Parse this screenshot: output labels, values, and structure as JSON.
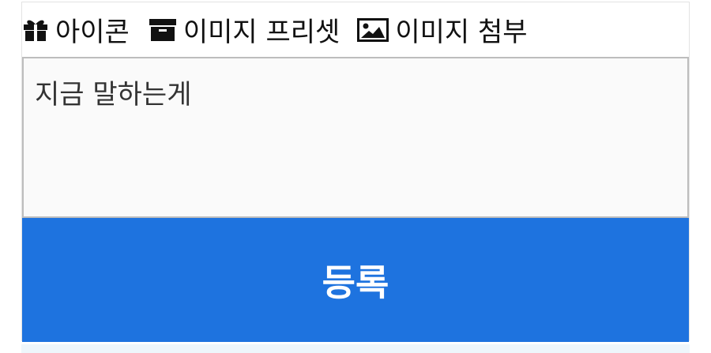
{
  "toolbar": {
    "items": [
      {
        "label": "아이콘",
        "icon": "gift-icon"
      },
      {
        "label": "이미지 프리셋",
        "icon": "archive-box-icon"
      },
      {
        "label": "이미지 첨부",
        "icon": "image-icon"
      }
    ]
  },
  "comment": {
    "value": "지금 말하는게"
  },
  "submit": {
    "label": "등록",
    "color": "#1e73df"
  }
}
